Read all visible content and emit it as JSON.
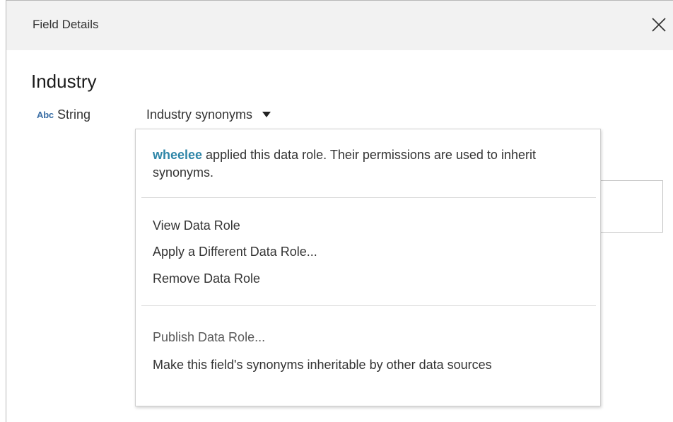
{
  "dialog": {
    "title": "Field Details",
    "close_icon": "close-icon"
  },
  "field": {
    "name": "Industry",
    "type_icon_text": "Abc",
    "type_label": "String"
  },
  "data_role": {
    "selected": "Industry synonyms",
    "dropdown_icon": "caret-down-icon"
  },
  "menu": {
    "info": {
      "user": "wheelee",
      "text": " applied this data role. Their permissions are used to inherit synonyms."
    },
    "group1": [
      "View Data Role",
      "Apply a Different Data Role...",
      "Remove Data Role"
    ],
    "group2": [
      "Publish Data Role...",
      "Make this field's synonyms inheritable by other data sources"
    ]
  }
}
